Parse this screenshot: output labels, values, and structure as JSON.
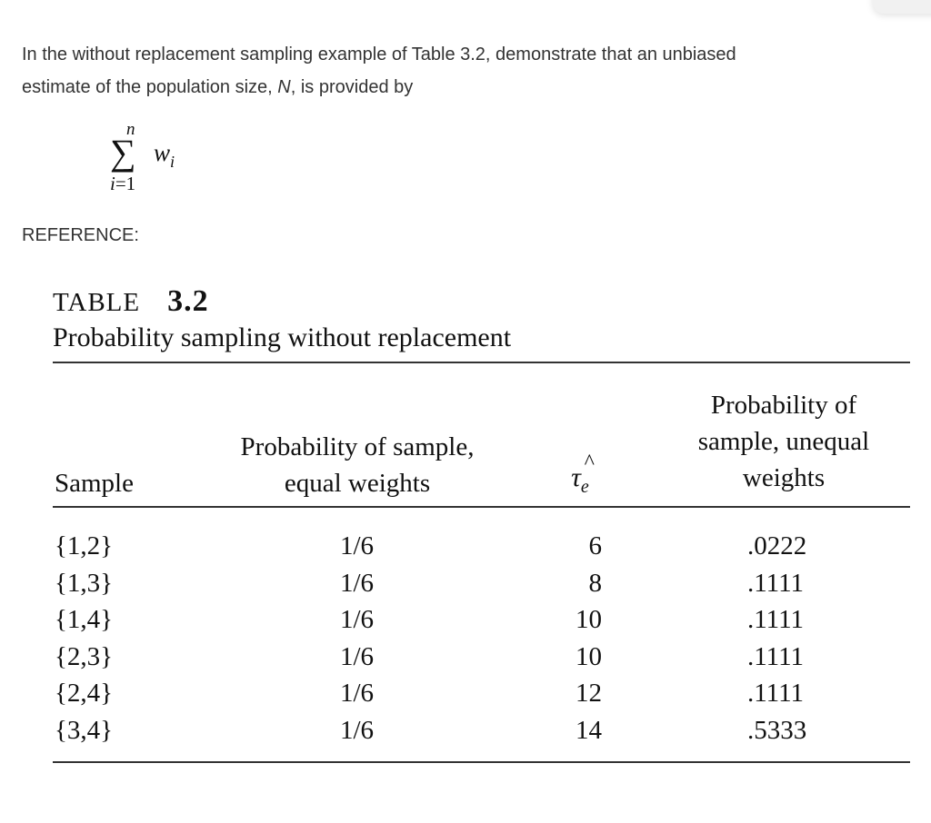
{
  "question": {
    "line1": "In the without replacement sampling example of Table 3.2, demonstrate that an unbiased",
    "line2_prefix": "estimate of the population size, ",
    "line2_var": "N",
    "line2_suffix": ", is provided by"
  },
  "formula": {
    "upper_limit": "n",
    "operator": "∑",
    "term": "w",
    "term_subscript": "i",
    "lower_index": "i",
    "lower_eq": "=1"
  },
  "reference_label": "REFERENCE:",
  "table": {
    "label": "TABLE",
    "number": "3.2",
    "caption": "Probability sampling without replacement",
    "headers": {
      "sample": "Sample",
      "equal_line1": "Probability of sample,",
      "equal_line2": "equal weights",
      "tau_symbol": "τ",
      "tau_hat": "^",
      "tau_subscript": "e",
      "unequal_line1": "Probability of",
      "unequal_line2": "sample, unequal",
      "unequal_line3": "weights"
    },
    "rows": [
      {
        "sample": "{1,2}",
        "equal": "1/6",
        "tau": "6",
        "unequal": ".0222"
      },
      {
        "sample": "{1,3}",
        "equal": "1/6",
        "tau": "8",
        "unequal": ".1111"
      },
      {
        "sample": "{1,4}",
        "equal": "1/6",
        "tau": "10",
        "unequal": ".1111"
      },
      {
        "sample": "{2,3}",
        "equal": "1/6",
        "tau": "10",
        "unequal": ".1111"
      },
      {
        "sample": "{2,4}",
        "equal": "1/6",
        "tau": "12",
        "unequal": ".1111"
      },
      {
        "sample": "{3,4}",
        "equal": "1/6",
        "tau": "14",
        "unequal": ".5333"
      }
    ]
  }
}
